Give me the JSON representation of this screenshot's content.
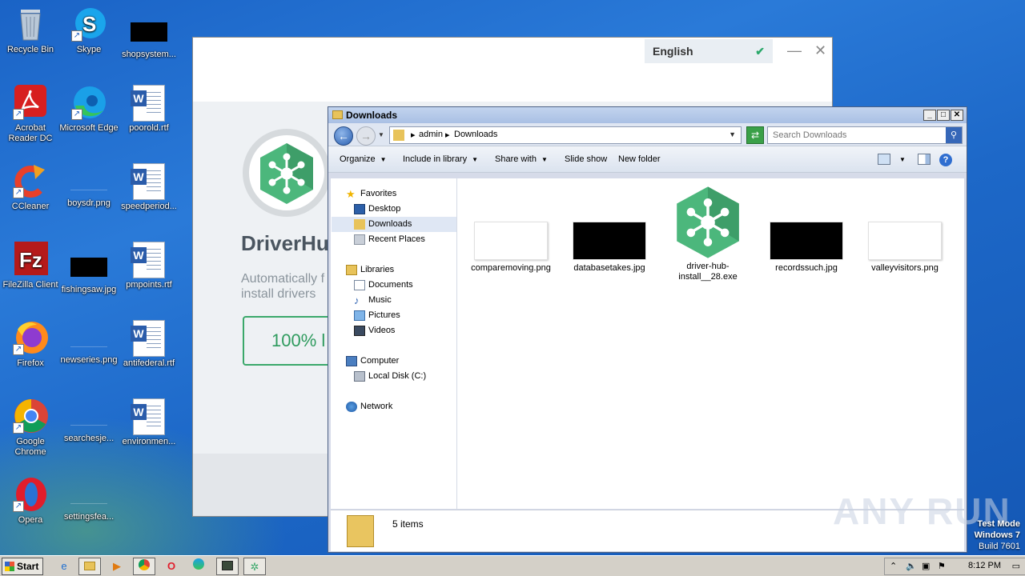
{
  "desktop": {
    "icons": [
      {
        "label": "Recycle Bin"
      },
      {
        "label": "Skype"
      },
      {
        "label": "shopsystem..."
      },
      {
        "label": "Acrobat Reader DC"
      },
      {
        "label": "Microsoft Edge"
      },
      {
        "label": "poorold.rtf"
      },
      {
        "label": "CCleaner"
      },
      {
        "label": "boysdr.png"
      },
      {
        "label": "speedperiod..."
      },
      {
        "label": "FileZilla Client"
      },
      {
        "label": "fishingsaw.jpg"
      },
      {
        "label": "pmpoints.rtf"
      },
      {
        "label": "Firefox"
      },
      {
        "label": "newseries.png"
      },
      {
        "label": "antifederal.rtf"
      },
      {
        "label": "Google Chrome"
      },
      {
        "label": "searchesje..."
      },
      {
        "label": "environmen..."
      },
      {
        "label": "Opera"
      },
      {
        "label": "settingsfea..."
      }
    ]
  },
  "driverhub": {
    "language": "English",
    "brand": "DriverHu",
    "tagline": "Automatically f install drivers",
    "badge": "100% l"
  },
  "explorer": {
    "title": "Downloads",
    "breadcrumb": [
      "admin",
      "Downloads"
    ],
    "search_placeholder": "Search Downloads",
    "toolbar": {
      "organize": "Organize",
      "include": "Include in library",
      "share": "Share with",
      "slideshow": "Slide show",
      "newfolder": "New folder"
    },
    "nav": {
      "favorites": "Favorites",
      "desktop": "Desktop",
      "downloads": "Downloads",
      "recent": "Recent Places",
      "libraries": "Libraries",
      "documents": "Documents",
      "music": "Music",
      "pictures": "Pictures",
      "videos": "Videos",
      "computer": "Computer",
      "localdisk": "Local Disk (C:)",
      "network": "Network"
    },
    "files": [
      {
        "name": "comparemoving.png"
      },
      {
        "name": "databasetakes.jpg"
      },
      {
        "name": "driver-hub-install__28.exe"
      },
      {
        "name": "recordssuch.jpg"
      },
      {
        "name": "valleyvisitors.png"
      }
    ],
    "status": "5 items"
  },
  "watermark": "ANY RUN",
  "os": {
    "line1": "Test Mode",
    "line2": "Windows 7",
    "line3": "Build 7601"
  },
  "taskbar": {
    "start": "Start",
    "clock": "8:12 PM"
  },
  "colors": {
    "accent_green": "#3aa86a",
    "desktop_blue": "#1d68c8"
  }
}
